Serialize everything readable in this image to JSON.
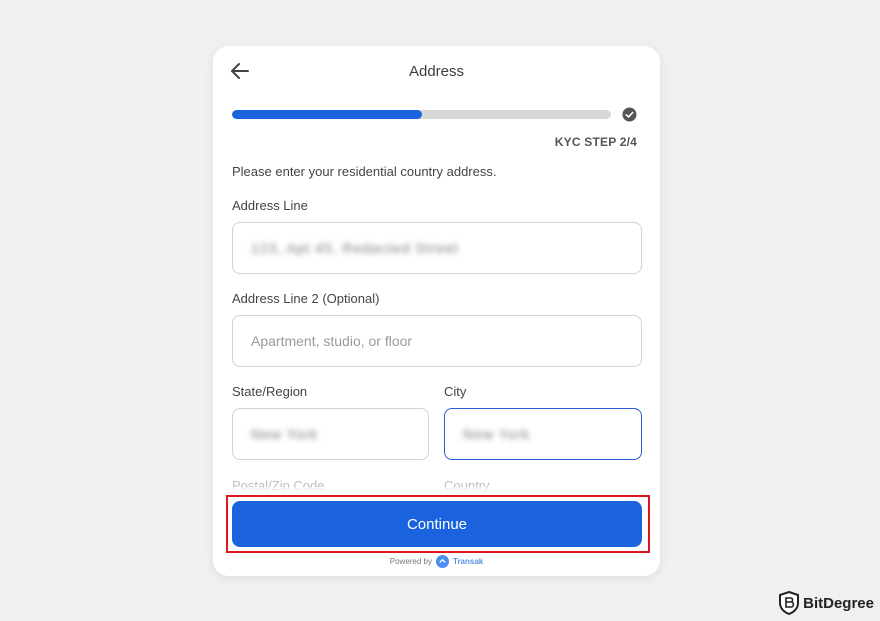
{
  "header": {
    "title": "Address",
    "back_icon": "arrow-left-icon"
  },
  "progress": {
    "fraction": 0.5,
    "step_label": "KYC STEP 2/4",
    "check_icon": "check-circle-icon"
  },
  "form": {
    "instruction": "Please enter your residential country address.",
    "address_line": {
      "label": "Address Line",
      "value": "123, Apt 45, Redacted Street"
    },
    "address_line_2": {
      "label": "Address Line 2 (Optional)",
      "placeholder": "Apartment, studio, or floor"
    },
    "state": {
      "label": "State/Region",
      "value": "New York"
    },
    "city": {
      "label": "City",
      "value": "New York"
    },
    "postal_label": "Postal/Zip Code",
    "country_label": "Country"
  },
  "footer": {
    "continue_label": "Continue",
    "powered_by": "Powered by",
    "brand": "Transak"
  },
  "watermark": {
    "text": "BitDegree"
  },
  "colors": {
    "accent": "#1a62de",
    "highlight": "#e0161f",
    "focus_border": "#2a5ed6"
  }
}
